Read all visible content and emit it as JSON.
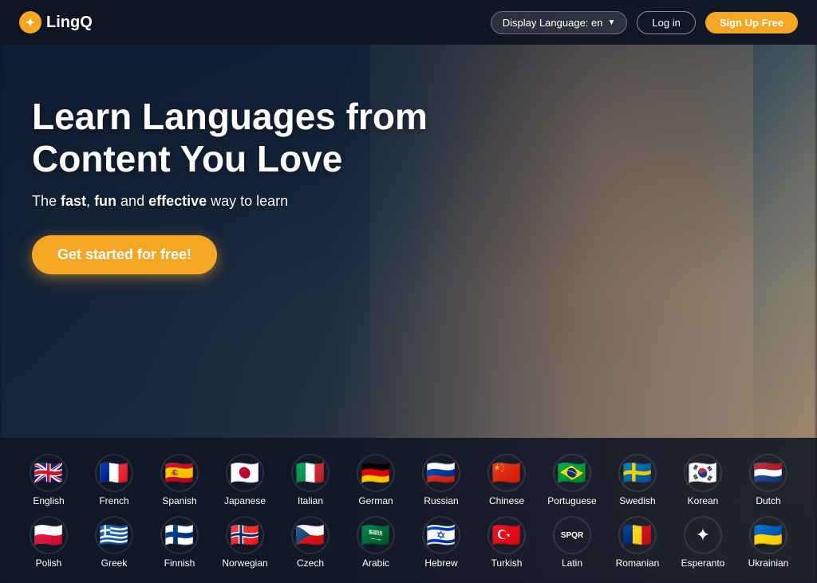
{
  "nav": {
    "logo_text": "LingQ",
    "lang_selector_label": "Display Language: en",
    "login_label": "Log in",
    "signup_label": "Sign Up Free"
  },
  "hero": {
    "title": "Learn Languages from Content You Love",
    "subtitle_prefix": "The ",
    "fast": "fast",
    "comma": ", ",
    "fun": "fun",
    "and": " and ",
    "effective": "effective",
    "suffix": " way to learn",
    "cta_label": "Get started for free!"
  },
  "languages_row1": [
    {
      "name": "English",
      "flag_class": "flag-english"
    },
    {
      "name": "French",
      "flag_class": "flag-french"
    },
    {
      "name": "Spanish",
      "flag_class": "flag-spanish"
    },
    {
      "name": "Japanese",
      "flag_class": "flag-japanese"
    },
    {
      "name": "Italian",
      "flag_class": "flag-italian"
    },
    {
      "name": "German",
      "flag_class": "flag-german"
    },
    {
      "name": "Russian",
      "flag_class": "flag-russian"
    },
    {
      "name": "Chinese",
      "flag_class": "flag-chinese"
    },
    {
      "name": "Portuguese",
      "flag_class": "flag-portuguese"
    },
    {
      "name": "Swedish",
      "flag_class": "flag-swedish"
    },
    {
      "name": "Korean",
      "flag_class": "flag-korean"
    },
    {
      "name": "Dutch",
      "flag_class": "flag-dutch"
    }
  ],
  "languages_row2": [
    {
      "name": "Polish",
      "flag_class": "flag-polish"
    },
    {
      "name": "Greek",
      "flag_class": "flag-greek"
    },
    {
      "name": "Finnish",
      "flag_class": "flag-finnish"
    },
    {
      "name": "Norwegian",
      "flag_class": "flag-norwegian"
    },
    {
      "name": "Czech",
      "flag_class": "flag-czech"
    },
    {
      "name": "Arabic",
      "flag_class": "flag-arabic"
    },
    {
      "name": "Hebrew",
      "flag_class": "flag-hebrew"
    },
    {
      "name": "Turkish",
      "flag_class": "flag-turkish"
    },
    {
      "name": "Latin",
      "flag_class": "flag-latin"
    },
    {
      "name": "Romanian",
      "flag_class": "flag-romanian"
    },
    {
      "name": "Esperanto",
      "flag_class": "flag-esperanto"
    },
    {
      "name": "Ukrainian",
      "flag_class": "flag-ukrainian"
    }
  ]
}
